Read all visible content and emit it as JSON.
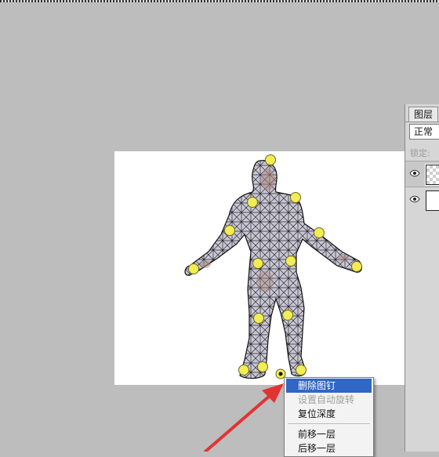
{
  "layers_panel": {
    "tab_label": "图层",
    "blend_mode": "正常",
    "lock_label": "锁定:",
    "layers": [
      {
        "thumb": "transparent-checker",
        "visible": true
      },
      {
        "thumb": "white",
        "visible": true
      }
    ]
  },
  "context_menu": {
    "items": [
      {
        "label": "删除图钉",
        "state": "selected"
      },
      {
        "label": "设置自动旋转",
        "state": "disabled"
      },
      {
        "label": "复位深度",
        "state": "normal"
      },
      {
        "label": "前移一层",
        "state": "normal"
      },
      {
        "label": "后移一层",
        "state": "normal"
      }
    ]
  },
  "colors": {
    "workspace": "#bdbdbd",
    "canvas": "#ffffff",
    "mesh_fill": "#c9c6d6",
    "pin": "#f2ec55",
    "menu_highlight": "#3166c5",
    "arrow": "#e23333"
  },
  "icons": {
    "eye": "eye-icon",
    "pin": "puppet-pin-icon",
    "arrow": "red-arrow-annotation"
  }
}
